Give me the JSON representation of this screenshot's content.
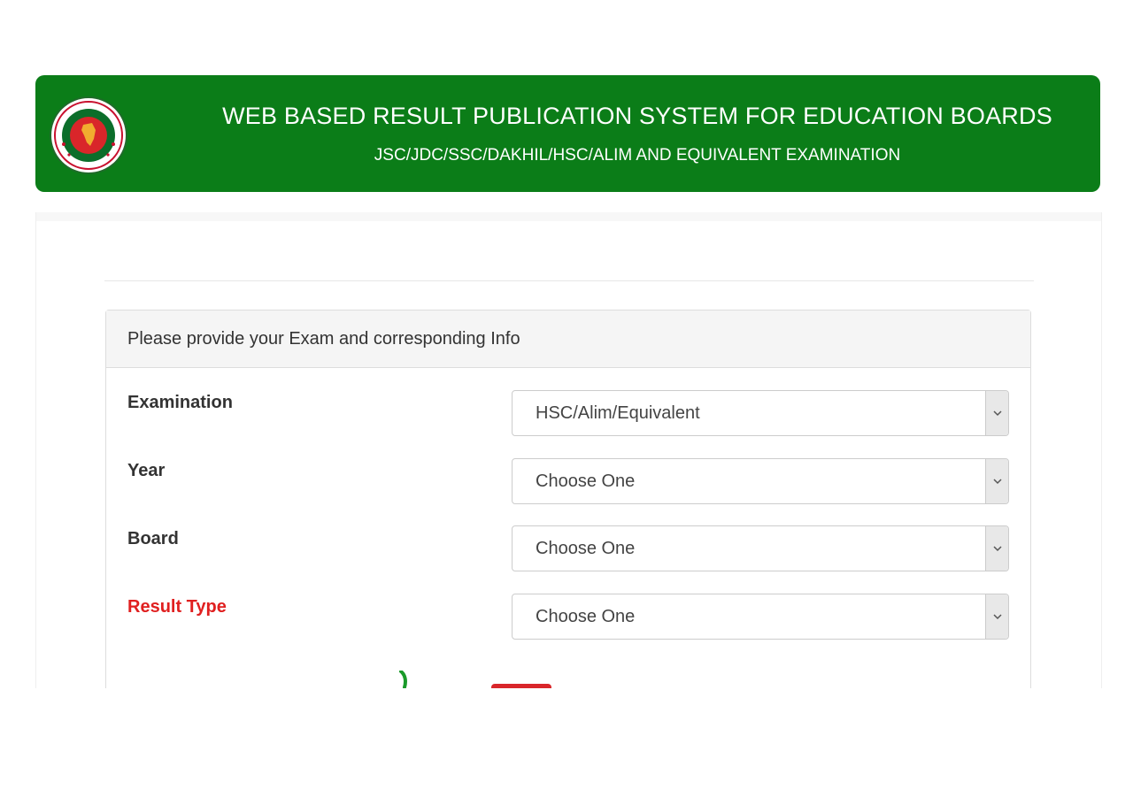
{
  "header": {
    "title": "WEB BASED RESULT PUBLICATION SYSTEM FOR EDUCATION BOARDS",
    "subtitle": "JSC/JDC/SSC/DAKHIL/HSC/ALIM AND EQUIVALENT EXAMINATION",
    "logo_icon": "government-seal-icon"
  },
  "panel": {
    "heading": "Please provide your Exam and corresponding Info"
  },
  "form": {
    "fields": [
      {
        "label": "Examination",
        "value": "HSC/Alim/Equivalent"
      },
      {
        "label": "Year",
        "value": "Choose One"
      },
      {
        "label": "Board",
        "value": "Choose One"
      },
      {
        "label": "Result Type",
        "value": "Choose One"
      }
    ]
  },
  "colors": {
    "header_bg": "#0b7d18",
    "result_type_label": "#e02020"
  }
}
